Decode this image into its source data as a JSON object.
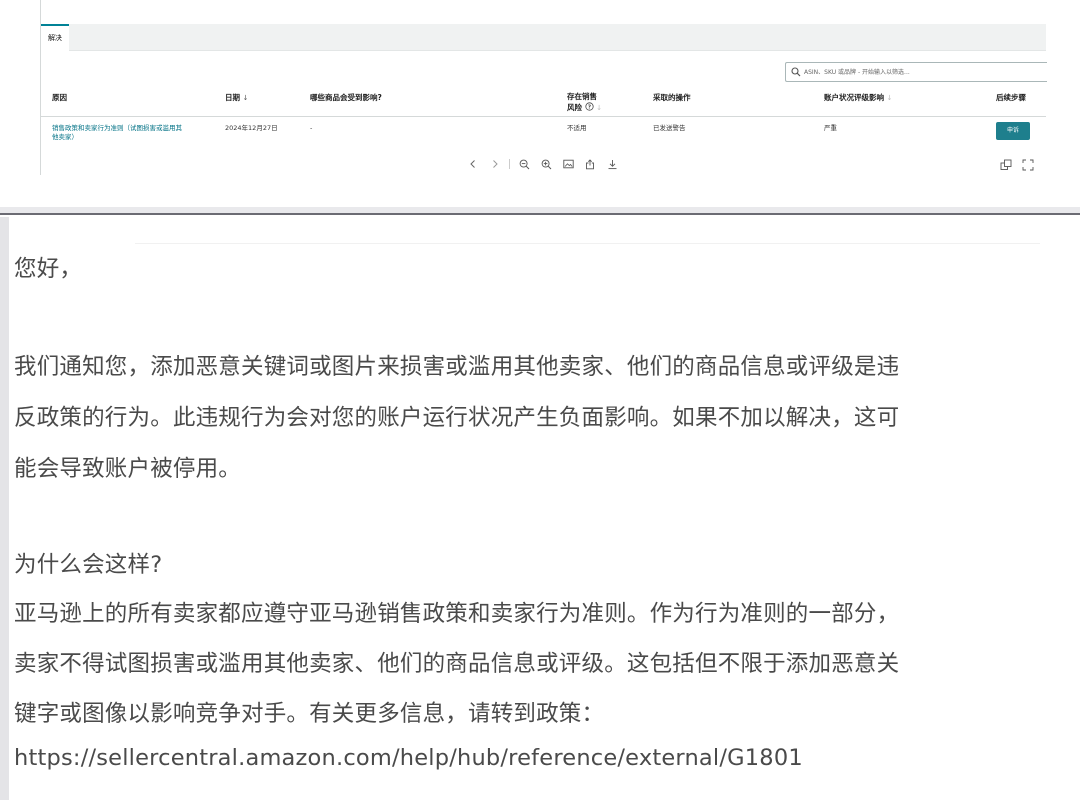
{
  "portal": {
    "tab": "解决",
    "search_placeholder": "ASIN、SKU 或品牌 - 开始输入以筛选...",
    "columns": {
      "reason": "原因",
      "date": "日期",
      "date_sort": "↓",
      "affected": "哪些商品会受到影响?",
      "risk_line1": "存在销售",
      "risk_line2": "风险",
      "action": "采取的操作",
      "impact": "账户状况评级影响",
      "next": "后续步骤"
    },
    "row": {
      "reason": "销售政策和卖家行为准则（试图损害或滥用其他卖家）",
      "date": "2024年12月27日",
      "affected": "-",
      "risk": "不适用",
      "action": "已发送警告",
      "impact": "严重",
      "next_button": "申诉"
    },
    "icons": [
      "chevron-left-icon",
      "chevron-right-icon",
      "zoom-out-icon",
      "zoom-in-icon",
      "image-icon",
      "share-icon",
      "download-icon",
      "copy-icon",
      "fullscreen-icon"
    ],
    "accent": "#008296",
    "button_color": "#1e7f8d"
  },
  "email": {
    "greeting": "您好，",
    "para1_line1": "我们通知您，添加恶意关键词或图片来损害或滥用其他卖家、他们的商品信息或评级是违",
    "para1_line2": "反政策的行为。此违规行为会对您的账户运行状况产生负面影响。如果不加以解决，这可",
    "para1_line3": "能会导致账户被停用。",
    "why_heading": "为什么会这样?",
    "para2_line1": "亚马逊上的所有卖家都应遵守亚马逊销售政策和卖家行为准则。作为行为准则的一部分，",
    "para2_line2": "卖家不得试图损害或滥用其他卖家、他们的商品信息或评级。这包括但不限于添加恶意关",
    "para2_line3": "键字或图像以影响竞争对手。有关更多信息，请转到政策：",
    "url": "https://sellercentral.amazon.com/help/hub/reference/external/G1801"
  }
}
